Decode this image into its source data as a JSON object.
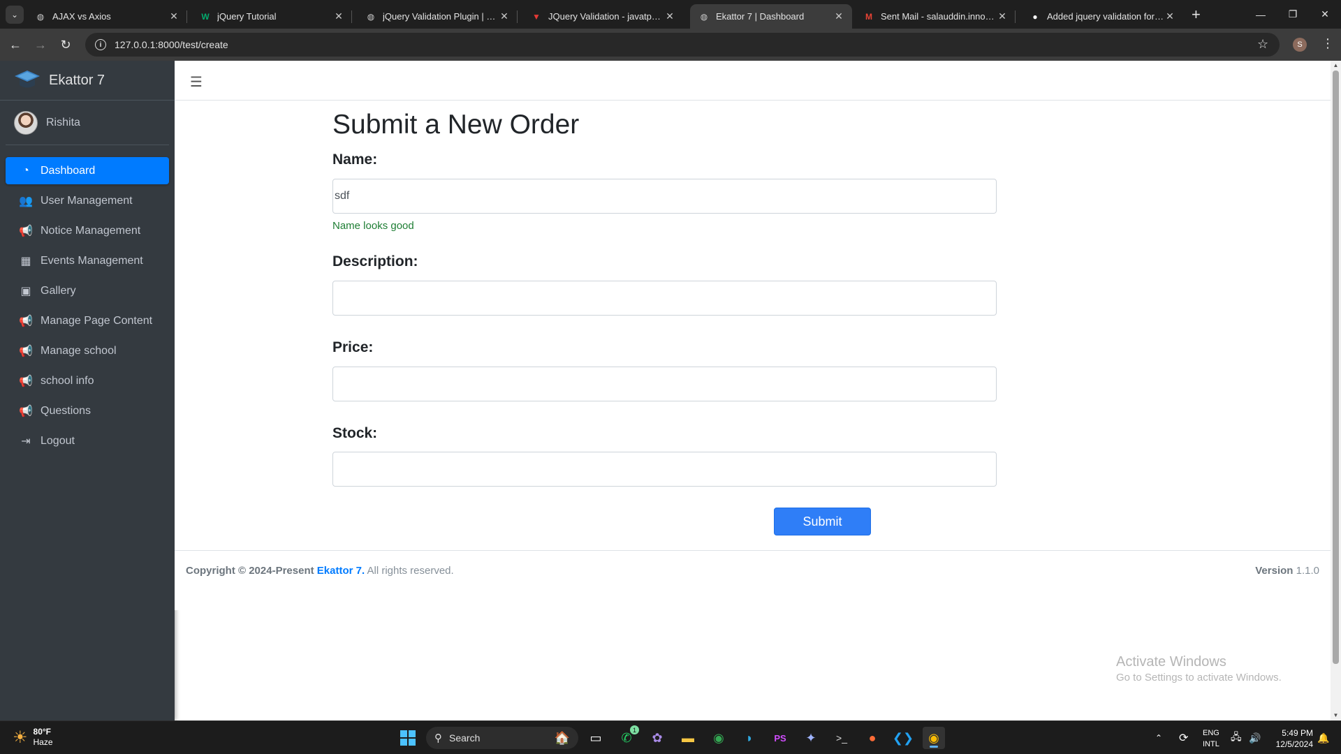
{
  "browser": {
    "tabs": [
      {
        "title": "AJAX vs Axios",
        "icon": "globe-icon",
        "active": false
      },
      {
        "title": "jQuery Tutorial",
        "icon": "w3schools-icon",
        "active": false
      },
      {
        "title": "jQuery Validation Plugin | Form",
        "icon": "globe-icon",
        "active": false
      },
      {
        "title": "JQuery Validation - javatpoint",
        "icon": "javatpoint-icon",
        "active": false
      },
      {
        "title": "Ekattor 7 | Dashboard",
        "icon": "globe-icon",
        "active": true
      },
      {
        "title": "Sent Mail - salauddin.innovx@g",
        "icon": "gmail-icon",
        "active": false
      },
      {
        "title": "Added jquery validation for nam",
        "icon": "github-icon",
        "active": false
      }
    ],
    "url": "127.0.0.1:8000/test/create",
    "profile_initial": "S"
  },
  "sidebar": {
    "brand": "Ekattor 7",
    "user": "Rishita",
    "items": [
      {
        "label": "Dashboard",
        "icon": "dashboard-icon",
        "active": true
      },
      {
        "label": "User Management",
        "icon": "users-icon",
        "active": false
      },
      {
        "label": "Notice Management",
        "icon": "megaphone-icon",
        "active": false
      },
      {
        "label": "Events Management",
        "icon": "calendar-icon",
        "active": false
      },
      {
        "label": "Gallery",
        "icon": "image-icon",
        "active": false
      },
      {
        "label": "Manage Page Content",
        "icon": "megaphone-icon",
        "active": false
      },
      {
        "label": "Manage school",
        "icon": "megaphone-icon",
        "active": false
      },
      {
        "label": "school info",
        "icon": "megaphone-icon",
        "active": false
      },
      {
        "label": "Questions",
        "icon": "megaphone-icon",
        "active": false
      },
      {
        "label": "Logout",
        "icon": "logout-icon",
        "active": false
      }
    ]
  },
  "form": {
    "title": "Submit a New Order",
    "name_label": "Name:",
    "name_value": "sdf",
    "name_valid": "Name looks good",
    "description_label": "Description:",
    "description_value": "",
    "price_label": "Price:",
    "price_value": "",
    "stock_label": "Stock:",
    "stock_value": "",
    "submit_label": "Submit"
  },
  "footer": {
    "copyright": "Copyright © 2024-Present",
    "brand": "Ekattor 7.",
    "rights": "All rights reserved.",
    "version_label": "Version",
    "version": "1.1.0"
  },
  "watermark": {
    "line1": "Activate Windows",
    "line2": "Go to Settings to activate Windows."
  },
  "taskbar": {
    "weather_temp": "80°F",
    "weather_desc": "Haze",
    "search_placeholder": "Search",
    "whatsapp_badge": "1",
    "lang_line1": "ENG",
    "lang_line2": "INTL",
    "time": "5:49 PM",
    "date": "12/5/2024"
  }
}
